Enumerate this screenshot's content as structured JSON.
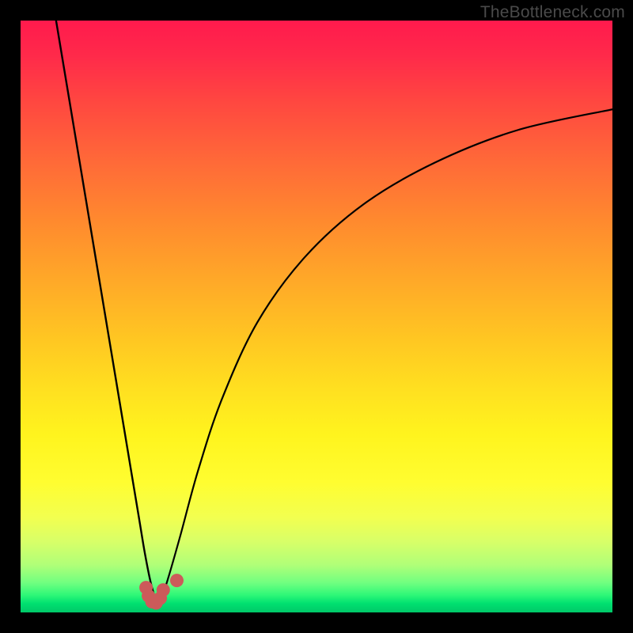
{
  "watermark": "TheBottleneck.com",
  "colors": {
    "frame": "#000000",
    "curve": "#000000",
    "marker_fill": "#cc5a5a",
    "marker_stroke": "#b74545",
    "gradient_top": "#ff1a4d",
    "gradient_bottom": "#00c868"
  },
  "chart_data": {
    "type": "line",
    "title": "",
    "xlabel": "",
    "ylabel": "",
    "xlim": [
      0,
      100
    ],
    "ylim": [
      0,
      100
    ],
    "grid": false,
    "legend": false,
    "note": "V-shaped bottleneck curve. x is a normalized component-balance axis (0-100). y is mismatch / bottleneck severity (0 = no bottleneck, 100 = worst). Optimum (minimum) near x ≈ 22-24. Left branch is steep and nearly linear; right branch rises with decreasing slope (concave).",
    "series": [
      {
        "name": "left-branch",
        "x": [
          6,
          8,
          10,
          12,
          14,
          16,
          18,
          20,
          21,
          22,
          23
        ],
        "y": [
          100,
          88,
          76,
          64,
          52,
          40,
          28,
          16,
          10,
          5,
          1.5
        ]
      },
      {
        "name": "right-branch",
        "x": [
          23,
          24,
          25,
          27,
          30,
          34,
          40,
          48,
          58,
          70,
          84,
          100
        ],
        "y": [
          1.5,
          3,
          6,
          13,
          24,
          36,
          49,
          60,
          69,
          76,
          81.5,
          85
        ]
      }
    ],
    "markers": {
      "name": "optimum-cluster",
      "points": [
        {
          "x": 21.2,
          "y": 4.2
        },
        {
          "x": 21.6,
          "y": 2.8
        },
        {
          "x": 22.2,
          "y": 1.8
        },
        {
          "x": 22.9,
          "y": 1.6
        },
        {
          "x": 23.6,
          "y": 2.4
        },
        {
          "x": 24.1,
          "y": 3.8
        },
        {
          "x": 26.4,
          "y": 5.4
        }
      ]
    }
  }
}
